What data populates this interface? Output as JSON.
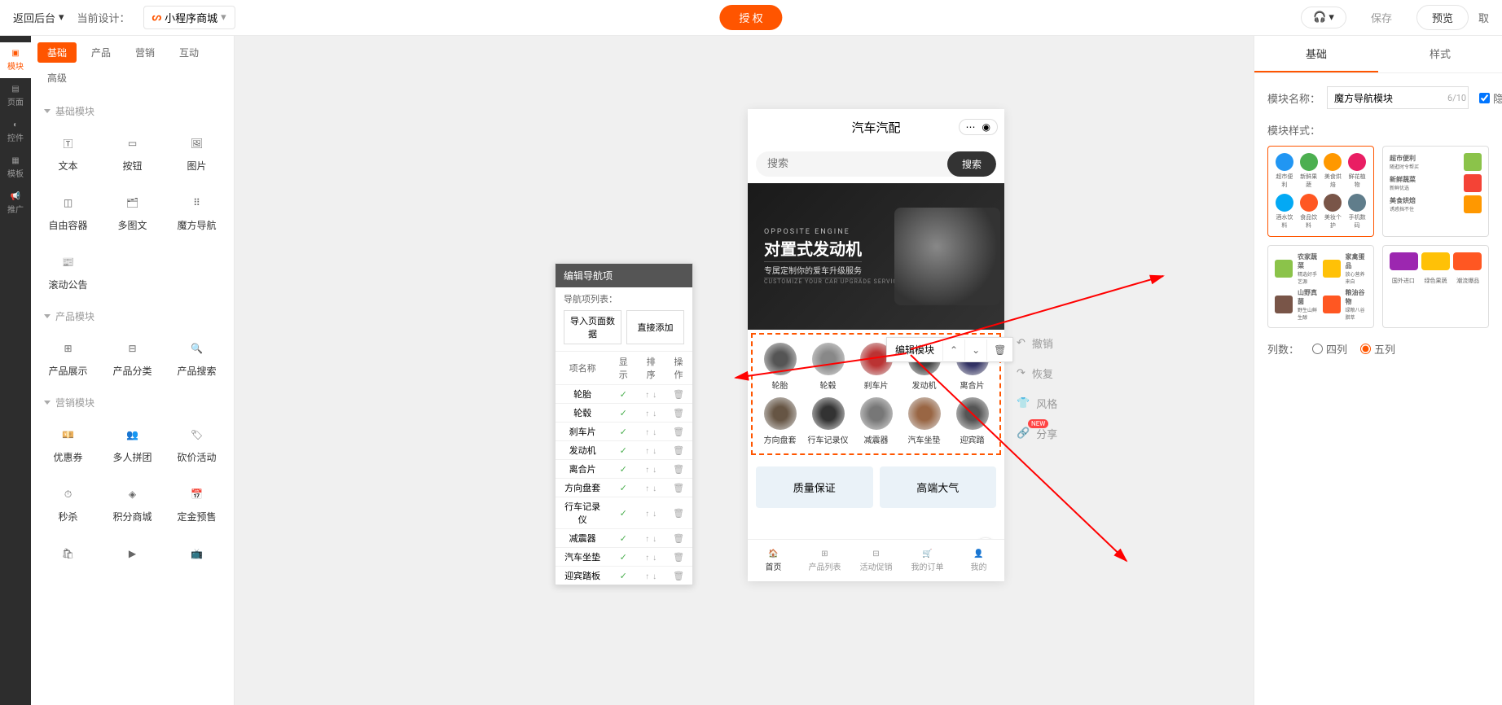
{
  "topbar": {
    "back": "返回后台",
    "current_design_label": "当前设计：",
    "design_name": "小程序商城",
    "auth_button": "授 权",
    "save": "保存",
    "preview": "预览",
    "cancel": "取"
  },
  "rail": [
    {
      "label": "模块",
      "active": true
    },
    {
      "label": "页面",
      "active": false
    },
    {
      "label": "控件",
      "active": false
    },
    {
      "label": "模板",
      "active": false
    },
    {
      "label": "推广",
      "active": false
    }
  ],
  "module_tabs": [
    "基础",
    "产品",
    "营销",
    "互动",
    "高级"
  ],
  "module_tab_active": 0,
  "sections": [
    {
      "title": "基础模块",
      "items": [
        "文本",
        "按钮",
        "图片",
        "自由容器",
        "多图文",
        "魔方导航",
        "滚动公告"
      ]
    },
    {
      "title": "产品模块",
      "items": [
        "产品展示",
        "产品分类",
        "产品搜索"
      ]
    },
    {
      "title": "营销模块",
      "items": [
        "优惠券",
        "多人拼团",
        "砍价活动",
        "秒杀",
        "积分商城",
        "定金预售"
      ]
    }
  ],
  "nav_popup": {
    "title": "编辑导航项",
    "list_label": "导航项列表：",
    "import_btn": "导入页面数据",
    "direct_add_btn": "直接添加",
    "columns": [
      "项名称",
      "显示",
      "排序",
      "操作"
    ],
    "items": [
      "轮胎",
      "轮毂",
      "刹车片",
      "发动机",
      "离合片",
      "方向盘套",
      "行车记录仪",
      "减震器",
      "汽车坐垫",
      "迎宾踏板"
    ]
  },
  "phone": {
    "title": "汽车汽配",
    "search_placeholder": "搜索",
    "search_btn": "搜索",
    "banner": {
      "t1": "OPPOSITE ENGINE",
      "t2": "对置式发动机",
      "t3": "专属定制你的爱车升级服务",
      "t4": "CUSTOMIZE YOUR CAR UPGRADE SERVICE"
    },
    "nav_items": [
      "轮胎",
      "轮毂",
      "刹车片",
      "发动机",
      "离合片",
      "方向盘套",
      "行车记录仪",
      "减震器",
      "汽车坐垫",
      "迎宾踏"
    ],
    "quality": [
      "质量保证",
      "高端大气"
    ],
    "tabs": [
      "首页",
      "产品列表",
      "活动促销",
      "我的订单",
      "我的"
    ]
  },
  "edit_module_bar": {
    "label": "编辑模块"
  },
  "side_actions": {
    "undo": "撤销",
    "redo": "恢复",
    "style": "风格",
    "share": "分享",
    "new": "NEW"
  },
  "props": {
    "tabs": [
      "基础",
      "样式"
    ],
    "tab_active": 0,
    "name_label": "模块名称：",
    "name_value": "魔方导航模块",
    "name_count": "6/10",
    "hide_label": "隐藏",
    "style_label": "模块样式：",
    "columns_label": "列数：",
    "col_options": [
      "四列",
      "五列"
    ],
    "col_selected": 1,
    "style_cards": {
      "c2": [
        {
          "t": "超市便利",
          "s": "随逛时令帮买"
        },
        {
          "t": "新鲜蔬菜",
          "s": "新鲜优选"
        },
        {
          "t": "美食烘焙",
          "s": "诱惑挡不住"
        }
      ],
      "c3": [
        {
          "t": "农家蔬菜",
          "s": "精选好手艺源"
        },
        {
          "t": "家禽蛋品",
          "s": "放心营养来自"
        },
        {
          "t": "山野真菌",
          "s": "野生山鲜生醇"
        },
        {
          "t": "粮油谷物",
          "s": "绿粮八谷腊萃"
        }
      ]
    }
  }
}
